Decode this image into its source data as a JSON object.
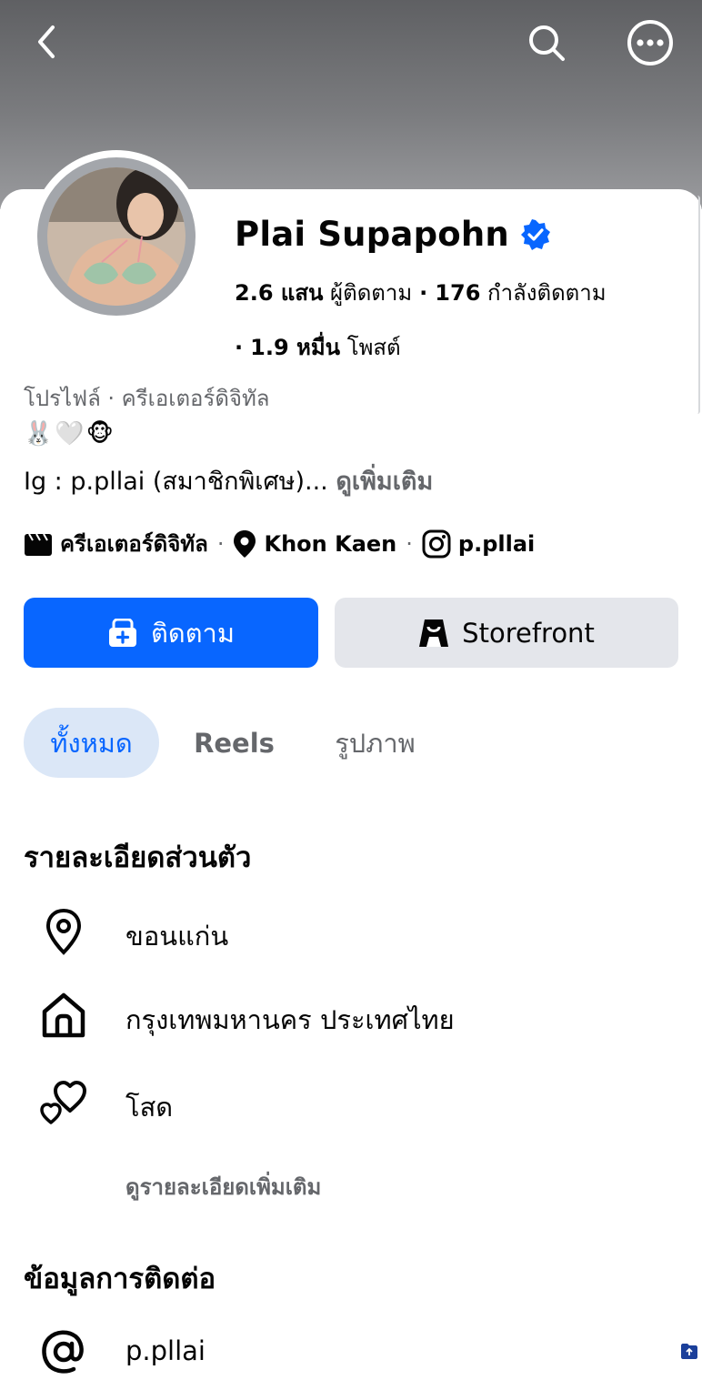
{
  "header": {
    "back_icon": "chevron-left-icon",
    "search_icon": "search-icon",
    "more_icon": "ellipsis-circle-icon"
  },
  "profile": {
    "name": "Plai Supapohn",
    "verified_icon": "verified-badge-icon",
    "followers_count": "2.6 แสน",
    "followers_label": "ผู้ติดตาม",
    "following_count": "176",
    "following_label": "กำลังติดตาม",
    "posts_count": "1.9 หมื่น",
    "posts_label": "โพสต์",
    "category_line": "โปรไฟล์ · ครีเอเตอร์ดิจิทัล",
    "emoji_line": "🐰🤍🐵",
    "bio": "Ig : p.pllai (สมาชิกพิเศษ)...",
    "see_more": "ดูเพิ่มเติม"
  },
  "details_row": {
    "category": "ครีเอเตอร์ดิจิทัล",
    "location": "Khon Kaen",
    "instagram": "p.pllai"
  },
  "actions": {
    "follow": "ติดตาม",
    "storefront": "Storefront"
  },
  "tabs": [
    {
      "label": "ทั้งหมด",
      "active": true
    },
    {
      "label": "Reels"
    },
    {
      "label": "รูปภาพ"
    }
  ],
  "personal_details": {
    "title": "รายละเอียดส่วนตัว",
    "items": [
      {
        "icon": "location-pin-icon",
        "text": "ขอนแก่น"
      },
      {
        "icon": "home-icon",
        "text": "กรุงเทพมหานคร ประเทศไทย"
      },
      {
        "icon": "hearts-icon",
        "text": "โสด"
      }
    ],
    "more": "ดูรายละเอียดเพิ่มเติม"
  },
  "contact": {
    "title": "ข้อมูลการติดต่อ",
    "items": [
      {
        "icon": "at-sign-icon",
        "text": "p.pllai"
      }
    ]
  },
  "colors": {
    "primary": "#0866ff",
    "secondary_button": "#e4e6eb",
    "muted_text": "#65676b",
    "active_tab_bg": "#dbe7f7"
  }
}
